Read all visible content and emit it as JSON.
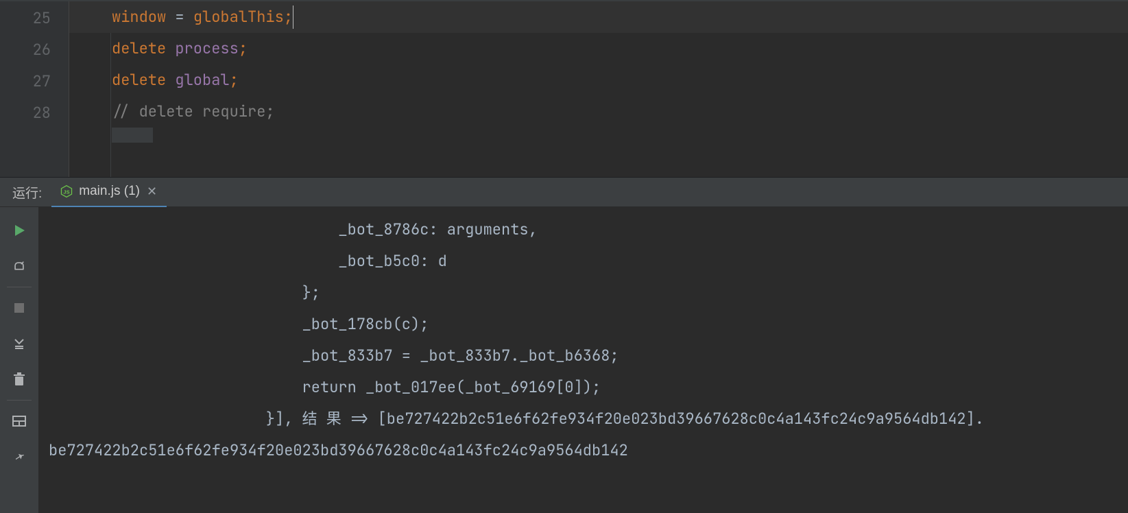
{
  "editor": {
    "lines": [
      {
        "num": "25",
        "tokens": [
          {
            "t": "window",
            "c": "tk-kw"
          },
          {
            "t": " = ",
            "c": "tk-op"
          },
          {
            "t": "globalThis",
            "c": "tk-global"
          },
          {
            "t": ";",
            "c": "tk-semi"
          }
        ],
        "active": true,
        "cursor_after_index": 3
      },
      {
        "num": "26",
        "tokens": [
          {
            "t": "delete ",
            "c": "tk-kw"
          },
          {
            "t": "process",
            "c": "tk-ident"
          },
          {
            "t": ";",
            "c": "tk-semi"
          }
        ]
      },
      {
        "num": "27",
        "tokens": [
          {
            "t": "delete ",
            "c": "tk-kw"
          },
          {
            "t": "global",
            "c": "tk-ident"
          },
          {
            "t": ";",
            "c": "tk-semi"
          }
        ]
      },
      {
        "num": "28",
        "tokens": [
          {
            "t": "// delete require;",
            "c": "tk-comment"
          }
        ]
      }
    ]
  },
  "run": {
    "panel_label": "运行:",
    "tab": {
      "filename": "main.js (1)"
    },
    "output": "                                _bot_8786c: arguments,\n                                _bot_b5c0: d\n                            };\n                            _bot_178cb(c);\n                            _bot_833b7 = _bot_833b7._bot_b6368;\n                            return _bot_017ee(_bot_69169[0]);\n                        }], 结 果 => [be727422b2c51e6f62fe934f20e023bd39667628c0c4a143fc24c9a9564db142].\nbe727422b2c51e6f62fe934f20e023bd39667628c0c4a143fc24c9a9564db142"
  },
  "icons": {
    "run": "run-icon",
    "wrench": "wrench-icon",
    "stop": "stop-icon",
    "scroll": "scroll-to-end-icon",
    "trash": "trash-icon",
    "layout": "split-layout-icon",
    "pin": "pin-icon",
    "nodejs": "nodejs-icon",
    "close": "close-icon"
  }
}
